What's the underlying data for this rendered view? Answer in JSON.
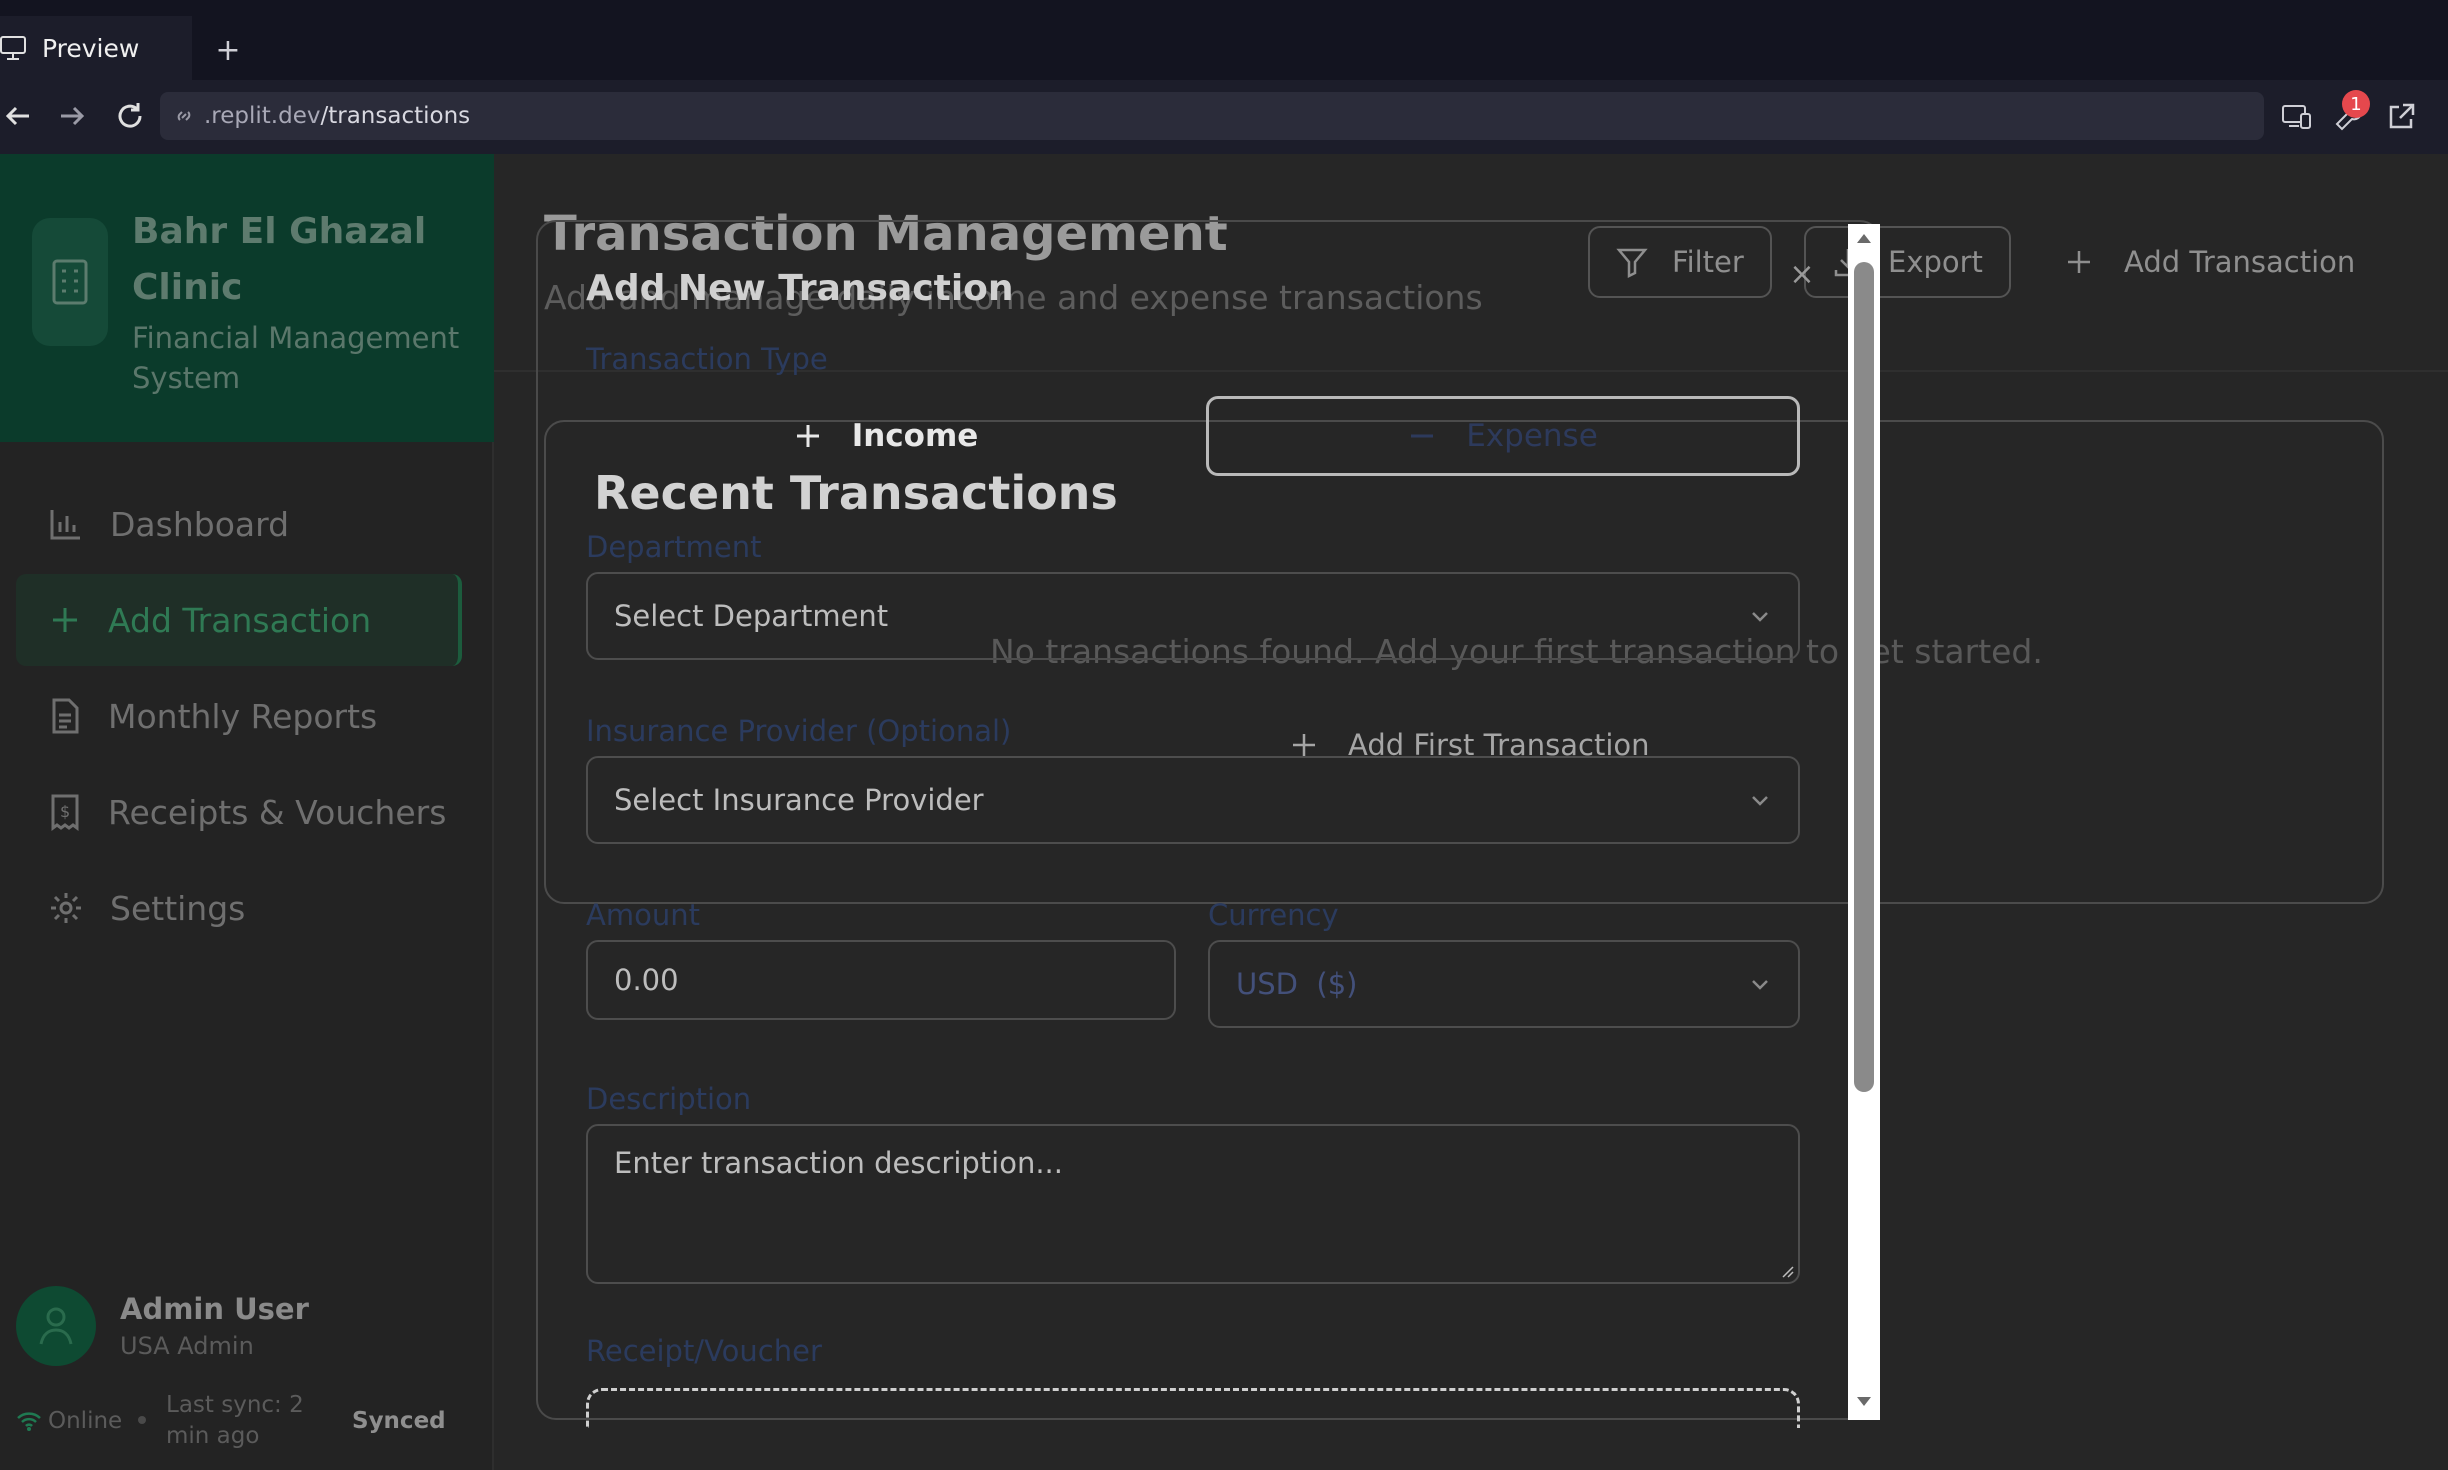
{
  "browser": {
    "tab_label": "Preview",
    "new_tab_glyph": "+",
    "url_host": ".replit.dev",
    "url_path": "/transactions",
    "notification_count": "1"
  },
  "sidebar": {
    "brand_title": "Bahr El Ghazal Clinic",
    "brand_subtitle": "Financial Management System",
    "items": [
      {
        "label": "Dashboard",
        "icon": "bar-chart-icon",
        "active": false
      },
      {
        "label": "Add Transaction",
        "icon": "plus-icon",
        "active": true
      },
      {
        "label": "Monthly Reports",
        "icon": "document-icon",
        "active": false
      },
      {
        "label": "Receipts & Vouchers",
        "icon": "receipt-icon",
        "active": false
      },
      {
        "label": "Settings",
        "icon": "gear-icon",
        "active": false
      }
    ],
    "user_name": "Admin User",
    "user_role": "USA Admin",
    "status_online": "Online",
    "last_sync": "Last sync: 2 min ago",
    "sync_state": "Synced"
  },
  "main": {
    "title": "Transaction Management",
    "subtitle": "Add and manage daily income and expense transactions",
    "filter_label": "Filter",
    "export_label": "Export",
    "add_transaction_label": "Add Transaction",
    "recent_title": "Recent Transactions",
    "empty_message": "No transactions found. Add your first transaction to get started.",
    "add_first_label": "Add First Transaction"
  },
  "modal": {
    "title": "Add New Transaction",
    "close_glyph": "×",
    "type_label": "Transaction Type",
    "income_label": "Income",
    "expense_label": "Expense",
    "department_label": "Department",
    "department_placeholder": "Select Department",
    "insurance_label": "Insurance Provider (Optional)",
    "insurance_placeholder": "Select Insurance Provider",
    "amount_label": "Amount",
    "amount_placeholder": "0.00",
    "currency_label": "Currency",
    "currency_code": "USD",
    "currency_symbol": "($)",
    "description_label": "Description",
    "description_placeholder": "Enter transaction description...",
    "receipt_label": "Receipt/Voucher"
  },
  "colors": {
    "brand_green": "#0b3b2b",
    "active_green": "#2f7a54",
    "label_navy": "#2b3b5e",
    "badge_red": "#e5484d"
  }
}
